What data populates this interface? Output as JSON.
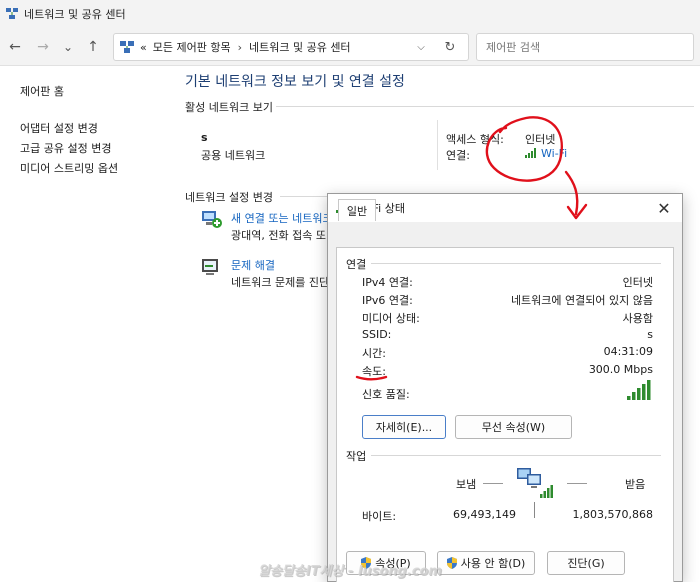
{
  "window": {
    "title": "네트워크 및 공유 센터"
  },
  "toolbar": {
    "back": "←",
    "forward": "→",
    "recent": "⌄",
    "up": "↑",
    "breadcrumb": [
      "모든 제어판 항목",
      "네트워크 및 공유 센터"
    ],
    "breadcrumb_prefix": "«",
    "breadcrumb_sep": "›",
    "refresh": "↻",
    "search_placeholder": "제어판 검색"
  },
  "sidebar": {
    "home": "제어판 홈",
    "links": [
      "어댑터 설정 변경",
      "고급 공유 설정 변경",
      "미디어 스트리밍 옵션"
    ]
  },
  "main": {
    "title": "기본 네트워크 정보 보기 및 연결 설정",
    "active_section": "활성 네트워크 보기",
    "network_name": "s",
    "network_type": "공용 네트워크",
    "access_label": "액세스 형식:",
    "access_value": "인터넷",
    "conn_label": "연결:",
    "conn_value": "Wi-Fi",
    "change_section": "네트워크 설정 변경",
    "tasks": [
      {
        "title": "새 연결 또는 네트워크",
        "desc": "광대역, 전화 접속 또"
      },
      {
        "title": "문제 해결",
        "desc": "네트워크 문제를 진단"
      }
    ]
  },
  "dialog": {
    "title": "Wi-Fi 상태",
    "close": "✕",
    "tab": "일반",
    "connection_group": "연결",
    "rows": [
      {
        "label": "IPv4 연결:",
        "value": "인터넷"
      },
      {
        "label": "IPv6 연결:",
        "value": "네트워크에 연결되어 있지 않음"
      },
      {
        "label": "미디어 상태:",
        "value": "사용함"
      },
      {
        "label": "SSID:",
        "value": "s"
      },
      {
        "label": "시간:",
        "value": "04:31:09"
      },
      {
        "label": "속도:",
        "value": "300.0 Mbps"
      },
      {
        "label": "신호 품질:",
        "value": ""
      }
    ],
    "signal_bars_filled": 5,
    "details_button": "자세히(E)...",
    "wireless_button": "무선 속성(W)",
    "activity_group": "작업",
    "sent_label": "보냄",
    "received_label": "받음",
    "bytes_label": "바이트:",
    "bytes_sent": "69,493,149",
    "bytes_received": "1,803,570,868",
    "properties_button": "속성(P)",
    "disable_button": "사용 안 함(D)",
    "diagnose_button": "진단(G)"
  },
  "colors": {
    "link": "#1565c0",
    "title": "#1e3f73",
    "signal": "#2e8b2e",
    "annotation": "#e0101b"
  },
  "watermark": "알송달송IT세상 - lusong.com"
}
